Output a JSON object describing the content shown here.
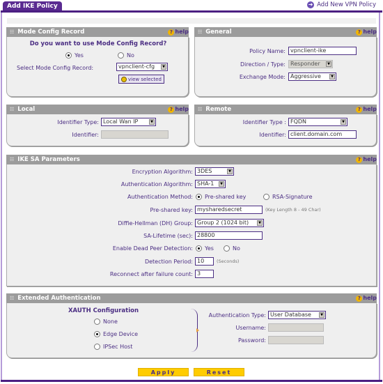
{
  "tab": {
    "label": "Add IKE Policy"
  },
  "add_new_link": {
    "label": "Add New VPN Policy"
  },
  "help_label": "help",
  "mode_config": {
    "title": "Mode Config Record",
    "question": "Do you want to use Mode Config Record?",
    "yes_label": "Yes",
    "no_label": "No",
    "selected": "Yes",
    "select_label": "Select Mode Config Record:",
    "select_value": "vpnclient-cfg",
    "view_button": "view selected"
  },
  "general": {
    "title": "General",
    "policy_name_label": "Policy Name:",
    "policy_name_value": "vpnclient-ike",
    "direction_label": "Direction / Type:",
    "direction_value": "Responder",
    "exchange_label": "Exchange Mode:",
    "exchange_value": "Aggressive"
  },
  "local": {
    "title": "Local",
    "id_type_label": "Identifier Type:",
    "id_type_value": "Local Wan IP",
    "id_label": "Identifier:",
    "id_value": ""
  },
  "remote": {
    "title": "Remote",
    "id_type_label": "Identifier Type :",
    "id_type_value": "FQDN",
    "id_label": "Identifier:",
    "id_value": "client.domain.com"
  },
  "ike_sa": {
    "title": "IKE SA Parameters",
    "enc_label": "Encryption Algorithm:",
    "enc_value": "3DES",
    "auth_alg_label": "Authentication Algorithm:",
    "auth_alg_value": "SHA-1",
    "auth_method_label": "Authentication Method:",
    "auth_method_options": [
      "Pre-shared key",
      "RSA-Signature"
    ],
    "auth_method_selected": "Pre-shared key",
    "psk_label": "Pre-shared key:",
    "psk_value": "mysharedsecret",
    "psk_hint": "(Key Length 8 - 49 Char)",
    "dh_label": "Diffie-Hellman (DH) Group:",
    "dh_value": "Group 2 (1024 bit)",
    "lifetime_label": "SA-Lifetime (sec):",
    "lifetime_value": "28800",
    "dpd_label": "Enable Dead Peer Detection:",
    "dpd_yes": "Yes",
    "dpd_no": "No",
    "dpd_selected": "Yes",
    "period_label": "Detection Period:",
    "period_value": "10",
    "period_hint": "(Seconds)",
    "reconnect_label": "Reconnect after failure count:",
    "reconnect_value": "3"
  },
  "xauth": {
    "title": "Extended Authentication",
    "config_title": "XAUTH Configuration",
    "options": [
      "None",
      "Edge Device",
      "IPSec Host"
    ],
    "selected": "Edge Device",
    "auth_type_label": "Authentication Type:",
    "auth_type_value": "User Database",
    "username_label": "Username:",
    "username_value": "",
    "password_label": "Password:",
    "password_value": ""
  },
  "buttons": {
    "apply": "Apply",
    "reset": "Reset"
  },
  "colors": {
    "brand_purple": "#4b1f82",
    "header_grey": "#9c9c9c",
    "button_yellow": "#ffcc00"
  }
}
